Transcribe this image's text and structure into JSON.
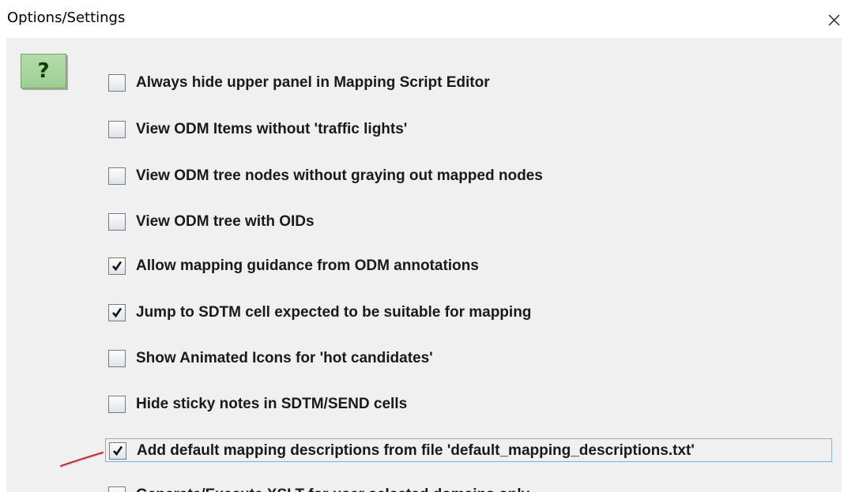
{
  "window": {
    "title": "Options/Settings",
    "close_icon": "close-icon"
  },
  "help": {
    "label": "?",
    "icon": "help-icon",
    "color": "#9ccf90"
  },
  "options": [
    {
      "label": "Always hide upper panel in Mapping Script Editor",
      "checked": false
    },
    {
      "label": "View ODM Items without 'traffic lights'",
      "checked": false
    },
    {
      "label": "View ODM tree nodes without graying out mapped nodes",
      "checked": false
    },
    {
      "label": "View ODM tree with OIDs",
      "checked": false
    },
    {
      "label": "Allow mapping guidance from ODM annotations",
      "checked": true
    },
    {
      "label": "Jump to SDTM cell expected to be suitable for mapping",
      "checked": true
    },
    {
      "label": "Show Animated Icons for 'hot candidates'",
      "checked": false
    },
    {
      "label": "Hide sticky notes in SDTM/SEND cells",
      "checked": false
    },
    {
      "label": "Add default mapping descriptions from file 'default_mapping_descriptions.txt'",
      "checked": true,
      "focused": true
    },
    {
      "label": "Generate/Execute XSLT for user selected domains only",
      "checked": false,
      "partially_visible": true
    }
  ],
  "annotation": {
    "icon": "red-annotation-line",
    "color": "#e8202a"
  }
}
